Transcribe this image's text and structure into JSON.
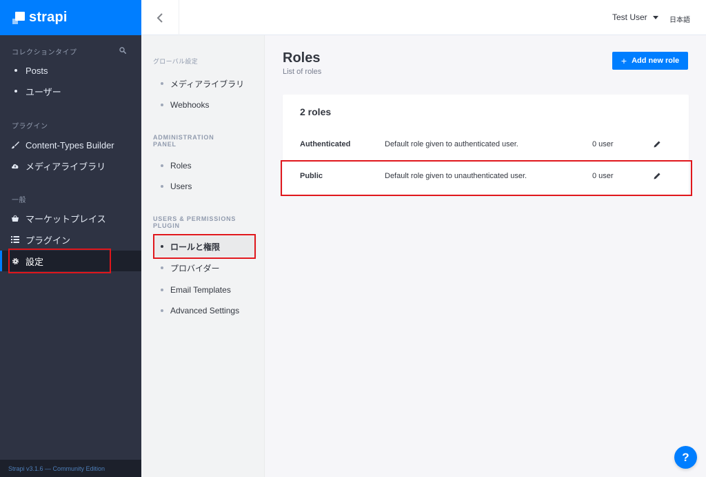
{
  "brand": {
    "name": "strapi"
  },
  "sidebar": {
    "section_collections": "コレクションタイプ",
    "collections": [
      {
        "label": "Posts"
      },
      {
        "label": "ユーザー"
      }
    ],
    "section_plugins": "プラグイン",
    "plugins": [
      {
        "label": "Content-Types Builder",
        "icon": "paintbrush-icon"
      },
      {
        "label": "メディアライブラリ",
        "icon": "cloud-upload-icon"
      }
    ],
    "section_general": "一般",
    "general": [
      {
        "label": "マーケットプレイス",
        "icon": "basket-icon"
      },
      {
        "label": "プラグイン",
        "icon": "list-icon"
      },
      {
        "label": "設定",
        "icon": "gear-icon"
      }
    ],
    "footer": "Strapi v3.1.6 — Community Edition"
  },
  "header": {
    "user": "Test User",
    "language": "日本語"
  },
  "subnav": {
    "global_title": "グローバル設定",
    "global_items": [
      {
        "label": "メディアライブラリ"
      },
      {
        "label": "Webhooks"
      }
    ],
    "admin_title": "ADMINISTRATION PANEL",
    "admin_items": [
      {
        "label": "Roles"
      },
      {
        "label": "Users"
      }
    ],
    "up_title": "USERS & PERMISSIONS PLUGIN",
    "up_items": [
      {
        "label": "ロールと権限"
      },
      {
        "label": "プロバイダー"
      },
      {
        "label": "Email Templates"
      },
      {
        "label": "Advanced Settings"
      }
    ]
  },
  "main": {
    "title": "Roles",
    "subtitle": "List of roles",
    "add_button": "Add new role",
    "add_plus": "+",
    "count_label": "2 roles",
    "roles": [
      {
        "name": "Authenticated",
        "description": "Default role given to authenticated user.",
        "users": "0 user"
      },
      {
        "name": "Public",
        "description": "Default role given to unauthenticated user.",
        "users": "0 user"
      }
    ]
  },
  "help": {
    "label": "?"
  },
  "colors": {
    "accent": "#007eff",
    "sidebar_bg": "#2e3343",
    "highlight": "#e0161b"
  }
}
